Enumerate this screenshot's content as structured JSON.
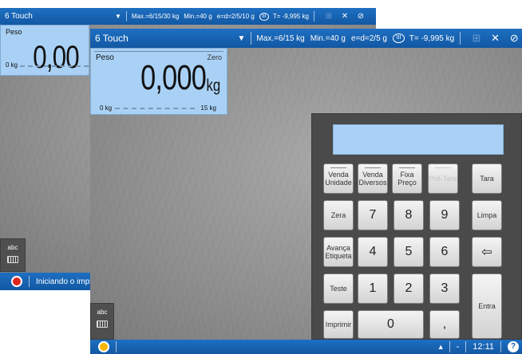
{
  "back_window": {
    "title": "6 Touch",
    "specs": {
      "max": "Max.=6/15/30 kg",
      "min": "Min.=40 g",
      "e": "e=d=2/5/10 g",
      "class": "III",
      "tare": "T= -9,995 kg"
    },
    "weight": {
      "label": "Peso",
      "value": "0,00",
      "scale_min": "0 kg"
    },
    "abc_label": "abc",
    "status_text": "Iniciando o impre"
  },
  "front_window": {
    "title": "6 Touch",
    "specs": {
      "max": "Max.=6/15 kg",
      "min": "Min.=40 g",
      "e": "e=d=2/5 g",
      "class": "III",
      "tare": "T= -9,995 kg"
    },
    "weight": {
      "label": "Peso",
      "zero": "Zero",
      "value": "0,000",
      "unit": "kg",
      "scale_min": "0 kg",
      "scale_max": "15 kg"
    },
    "abc_label": "abc",
    "status": {
      "dash": "-",
      "clock": "12:11",
      "help": "?"
    },
    "keypad": {
      "venda_unidade": [
        "Venda",
        "Unidade"
      ],
      "venda_diversos": [
        "Venda",
        "Diversos"
      ],
      "fixa_preco": [
        "Fixa",
        "Preço"
      ],
      "pre_tara": "Pré-Tara",
      "tara": "Tara",
      "zera": "Zera",
      "limpa": "Limpa",
      "avanca_etiqueta": [
        "Avança",
        "Etiqueta"
      ],
      "teste": "Teste",
      "imprimir": "Imprimir",
      "entra": "Entra",
      "digits": [
        "7",
        "8",
        "9",
        "4",
        "5",
        "6",
        "1",
        "2",
        "3",
        "0",
        ","
      ]
    }
  },
  "colors": {
    "titlebar": "#1258a3",
    "display": "#a9d1f5",
    "keypad_bg": "#4a4a4a",
    "status_dot_back": "#e0241e",
    "status_dot_front": "#f7b500"
  },
  "icons": [
    "caret-down-icon",
    "network-icon",
    "close-icon",
    "power-icon",
    "keyboard-icon",
    "backspace-icon",
    "triangle-up-icon",
    "help-icon"
  ]
}
